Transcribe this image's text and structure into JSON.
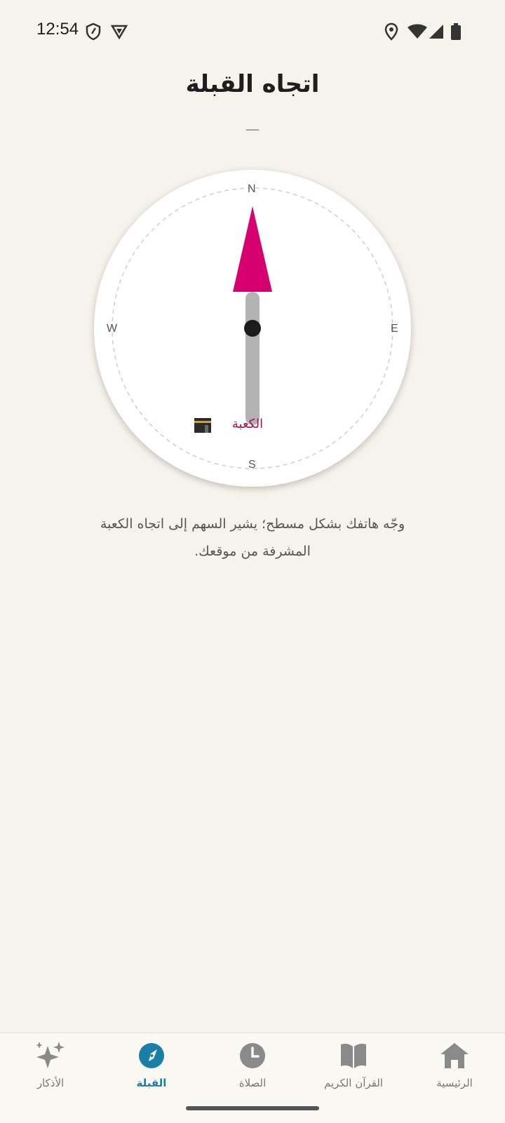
{
  "status": {
    "time": "12:54"
  },
  "page": {
    "title": "اتجاه القبلة",
    "heading_value": "—",
    "instruction": "وجّه هاتفك بشكل مسطح؛ يشير السهم إلى اتجاه الكعبة المشرفة من موقعك."
  },
  "compass": {
    "north": "N",
    "east": "E",
    "south": "S",
    "west": "W",
    "kaaba_label": "الكعبة",
    "arrow_color": "#d6006f",
    "needle_color": "#b3b3b3"
  },
  "nav": {
    "items": [
      {
        "label": "الرئيسية",
        "icon": "home-icon"
      },
      {
        "label": "القرآن الكريم",
        "icon": "book-icon"
      },
      {
        "label": "الصلاة",
        "icon": "clock-icon"
      },
      {
        "label": "القبلة",
        "icon": "compass-icon",
        "active": true
      },
      {
        "label": "الأذكار",
        "icon": "sparkle-icon"
      }
    ],
    "active_color": "#1a7fa8"
  }
}
